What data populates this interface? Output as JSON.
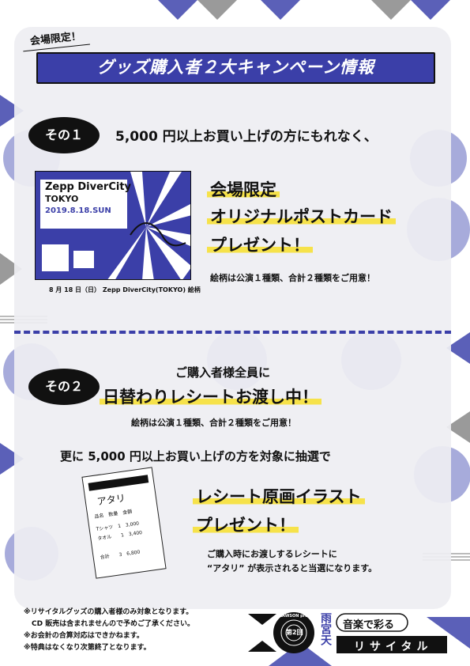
{
  "header": {
    "tag": "会場限定！",
    "title": "グッズ購入者２大キャンペーン情報"
  },
  "section1": {
    "badge": "その１",
    "lead": "5,000 円以上お買い上げの方にもれなく、",
    "headline_line1": "会場限定",
    "headline_line2": "オリジナルポストカード",
    "headline_line3": "プレゼント！",
    "note": "絵柄は公演１種類、合計２種類をご用意！",
    "card_title": "Zepp DiverCity",
    "card_subtitle": "TOKYO",
    "card_date": "2019.8.18.SUN",
    "card_caption": "8 月 18 日（日） Zepp DiverCity(TOKYO) 絵柄"
  },
  "section2": {
    "badge": "その２",
    "lead": "ご購入者様全員に",
    "headline": "日替わりレシートお渡し中！",
    "note": "絵柄は公演１種類、合計２種類をご用意！",
    "sublead": "更に 5,000 円以上お買い上げの方を対象に抽選で",
    "prize_line1": "レシート原画イラスト",
    "prize_line2": "プレゼント！",
    "detail_line1": "ご購入時にお渡しするレシートに",
    "detail_line2": "“アタリ” が表示されると当選になります。",
    "receipt_title": "アタリ",
    "receipt_header": "品名　数量　金額",
    "receipt_row1": "Tシャツ　1　3,000",
    "receipt_row2": "タオル　　1　3,400",
    "receipt_total": "合計　　3　6,800"
  },
  "notes": [
    "※リサイタルグッズの購入者様のみ対象となります。",
    "CD 販売は含まれませんので予めご了承ください。",
    "※お会計の合算対応はできかねます。",
    "※特典はなくなり次第終了となります。"
  ],
  "logo": {
    "sponsor": "LAWSON presents",
    "edition": "第2回",
    "artist": "雨宮天",
    "tagline": "音楽で彩る",
    "word": "リサイタル"
  },
  "colors": {
    "accent": "#3b3fa8",
    "highlight": "#f6e24a",
    "gray": "#9a9a9a"
  }
}
